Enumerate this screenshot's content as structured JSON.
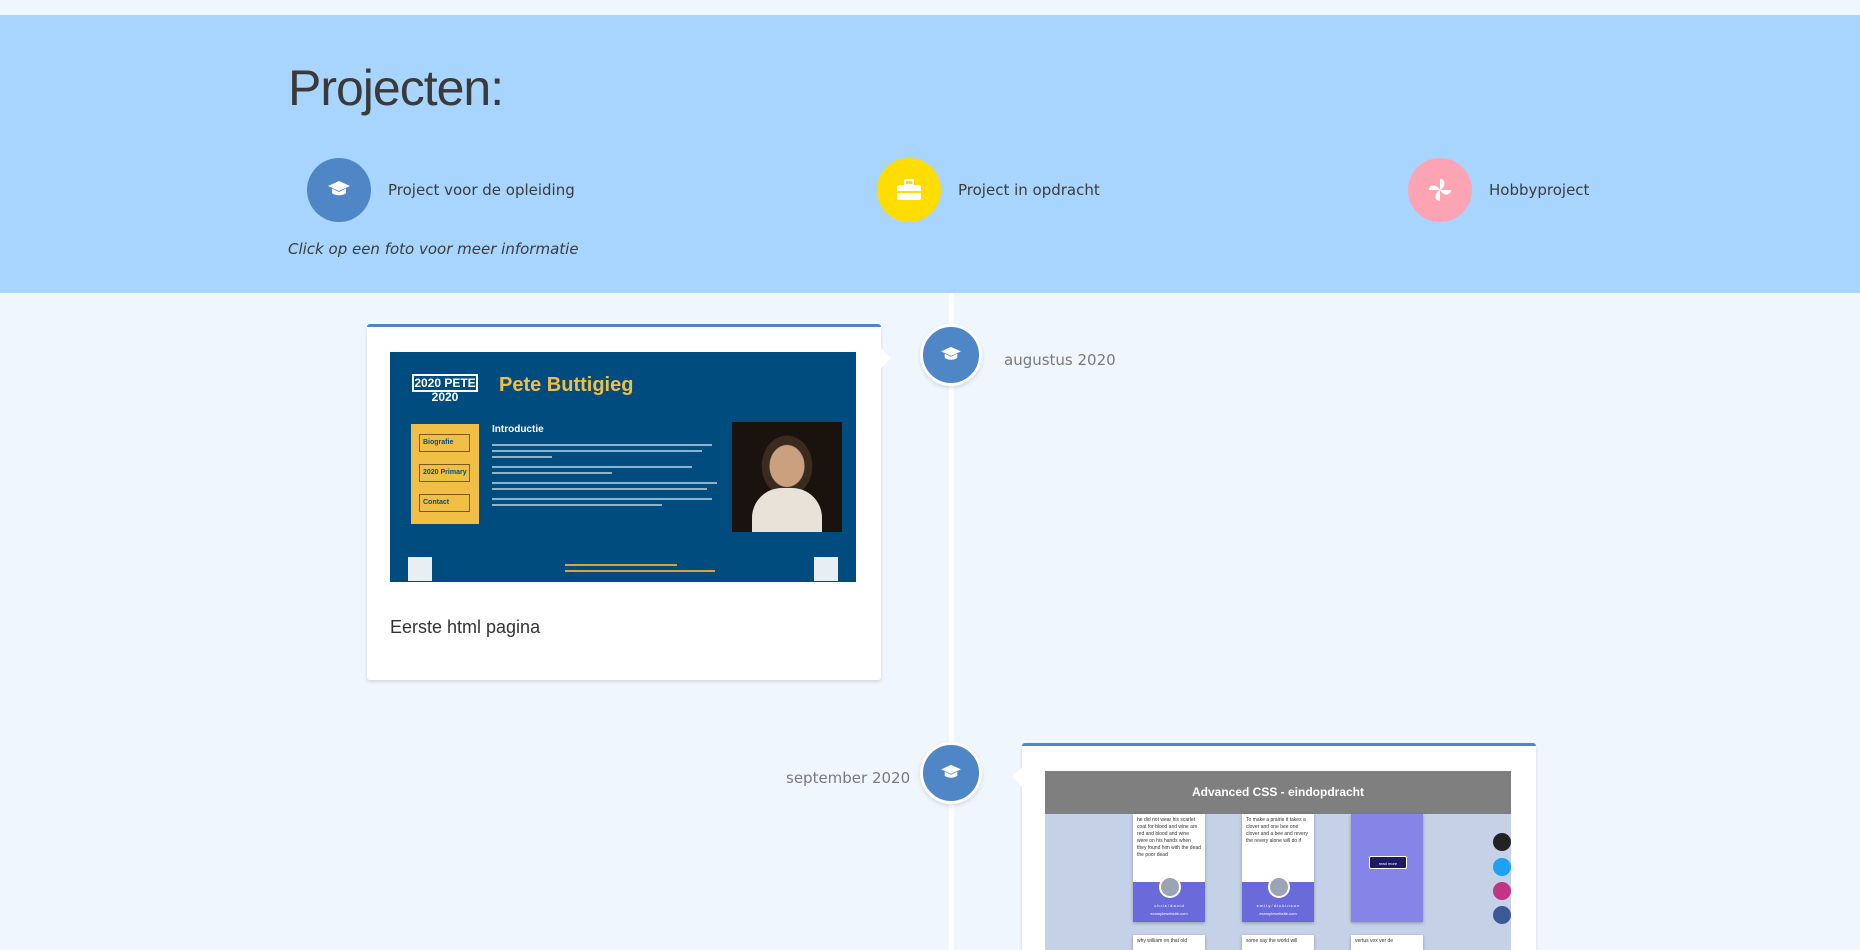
{
  "header": {
    "title": "Projecten:",
    "hint": "Click op een foto voor meer informatie"
  },
  "legend": [
    {
      "label": "Project voor de opleiding",
      "icon": "graduation-cap-icon",
      "color": "#4f86c6"
    },
    {
      "label": "Project in opdracht",
      "icon": "briefcase-icon",
      "color": "#ffdd00"
    },
    {
      "label": "Hobbyproject",
      "icon": "pinwheel-icon",
      "color": "#fda4b4"
    }
  ],
  "timeline": [
    {
      "date": "augustus 2020",
      "title": "Eerste html pagina",
      "icon": "graduation-cap-icon",
      "screenshot": {
        "logo": "2020 PETE 2020",
        "heading": "Pete Buttigieg",
        "menu": [
          "Biografie",
          "2020 Primary",
          "Contact"
        ],
        "section": "Introductie"
      }
    },
    {
      "date": "september 2020",
      "icon": "graduation-cap-icon",
      "screenshot": {
        "heading": "Advanced CSS - eindopdracht",
        "tiles": [
          {
            "text": "he did not wear his scarlet coat for blood and wine are red and blood and wine were on his hands when they found him with the dead the poor dead",
            "name": "c.h.r.i.s / d.a.v.i.d",
            "site": "examplewebsite.com"
          },
          {
            "text": "To make a prairie it takes a clover and one bee one clover and a bee and revery the revery alone will do if",
            "name": "e.m.i.l.y / d.i.c.k.i.n.s.o.n",
            "site": "examplewebsite.com"
          },
          {
            "button": "read more"
          }
        ],
        "row2": [
          "why william on that old",
          "some say the world will",
          "vertus vox ver de"
        ]
      }
    }
  ]
}
